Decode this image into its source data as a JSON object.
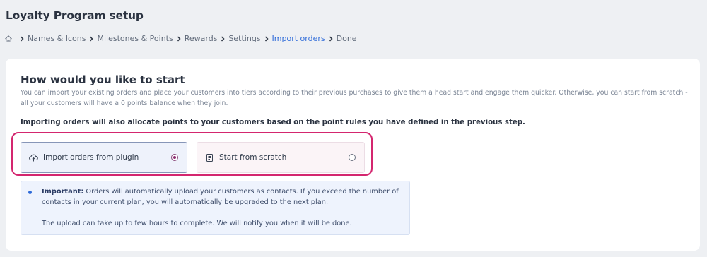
{
  "header": {
    "title": "Loyalty Program setup"
  },
  "breadcrumb": {
    "items": [
      {
        "label": "Names & Icons"
      },
      {
        "label": "Milestones & Points"
      },
      {
        "label": "Rewards"
      },
      {
        "label": "Settings"
      },
      {
        "label": "Import orders",
        "active": true
      },
      {
        "label": "Done"
      }
    ]
  },
  "card": {
    "title": "How would you like to start",
    "description": "You can import your existing orders and place your customers into tiers according to their previous purchases to give them a head start and engage them quicker. Otherwise, you can start from scratch - all your customers will have a 0 points balance when they join.",
    "note": "Importing orders will also allocate points to your customers based on the point rules you have defined in the previous step.",
    "options": [
      {
        "label": "Import orders from plugin",
        "selected": true,
        "icon": "upload-cloud-icon"
      },
      {
        "label": "Start from scratch",
        "selected": false,
        "icon": "document-icon"
      }
    ],
    "info": {
      "important_label": "Important:",
      "line1": " Orders will automatically upload your customers as contacts. If you exceed the number of",
      "line2": "contacts in your current plan, you will automatically be upgraded to the next plan.",
      "line3": "The upload can take up to few hours to complete. We will notify you when it will be done."
    }
  },
  "colors": {
    "accent_link": "#2f6bd9",
    "highlight_border": "#d4266f",
    "selected_radio": "#8a2a6f"
  }
}
